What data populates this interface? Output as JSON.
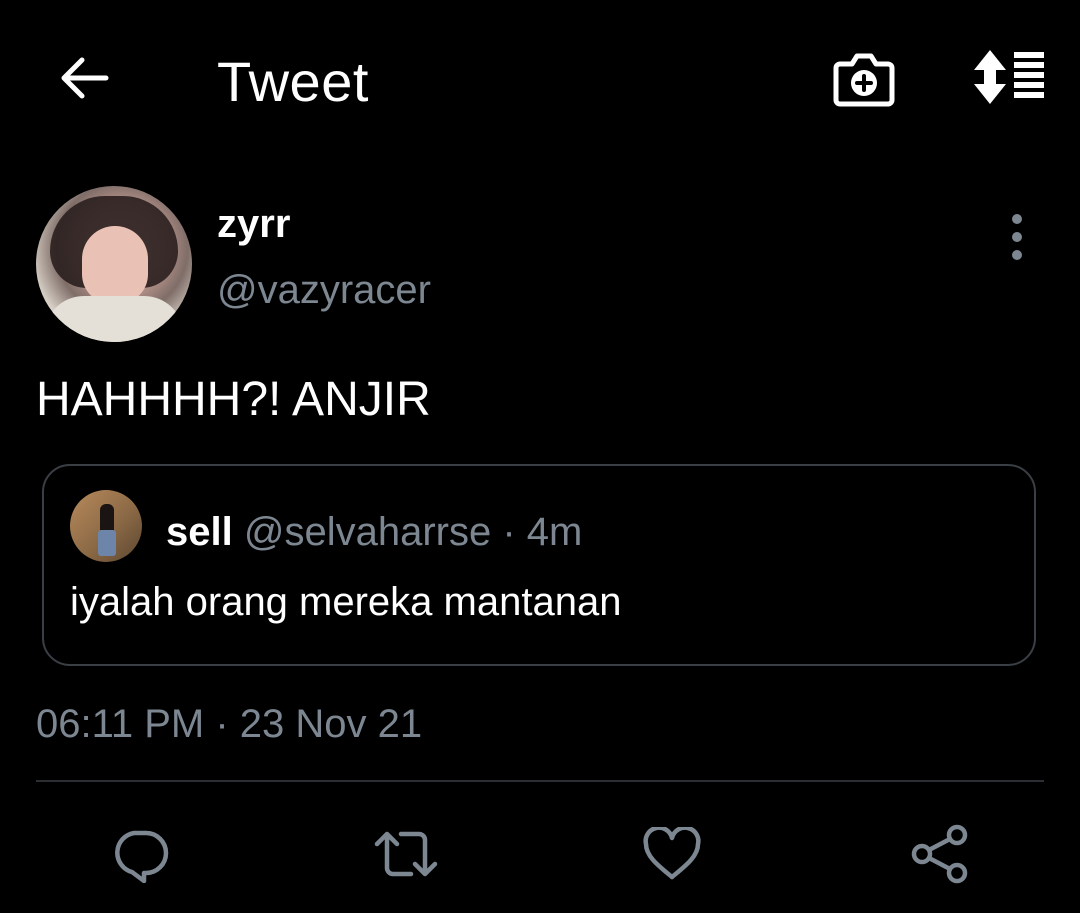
{
  "header": {
    "title": "Tweet",
    "icons": [
      "back-arrow-icon",
      "add-photo-icon",
      "sort-lines-icon"
    ]
  },
  "tweet": {
    "author": {
      "name": "zyrr",
      "handle": "@vazyracer"
    },
    "text": "HAHHHH?! ANJIR",
    "quoted": {
      "name": "sell",
      "handle": "@selvaharrse",
      "separator": "·",
      "time": "4m",
      "text": "iyalah orang mereka mantanan"
    },
    "timestamp": "06:11 PM · 23 Nov 21"
  },
  "actions": [
    "reply-icon",
    "retweet-icon",
    "like-icon",
    "share-icon"
  ],
  "colors": {
    "background": "#000000",
    "text": "#ffffff",
    "secondary_text": "#7d8791",
    "border": "#3a3f45",
    "divider": "#2b2f34"
  }
}
